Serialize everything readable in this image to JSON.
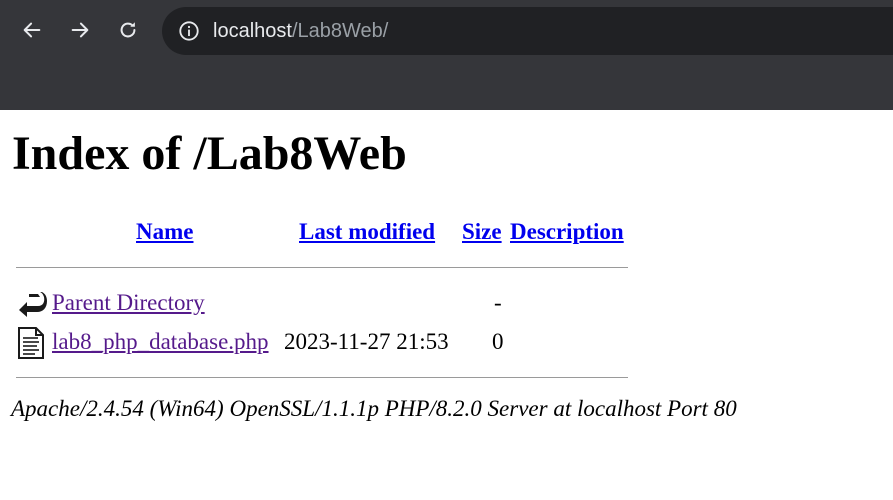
{
  "browser": {
    "url_host": "localhost",
    "url_path": "/Lab8Web/"
  },
  "page": {
    "title": "Index of /Lab8Web",
    "table": {
      "headers": {
        "name": "Name",
        "last_modified": "Last modified",
        "size": "Size",
        "description": "Description"
      },
      "rows": [
        {
          "icon": "back-folder-icon",
          "name": "Parent Directory",
          "last_modified": "",
          "size": "-",
          "description": ""
        },
        {
          "icon": "text-file-icon",
          "name": "lab8_php_database.php",
          "last_modified": "2023-11-27 21:53",
          "size": "0",
          "description": ""
        }
      ]
    },
    "server_signature": "Apache/2.4.54 (Win64) OpenSSL/1.1.1p PHP/8.2.0 Server at localhost Port 80"
  }
}
